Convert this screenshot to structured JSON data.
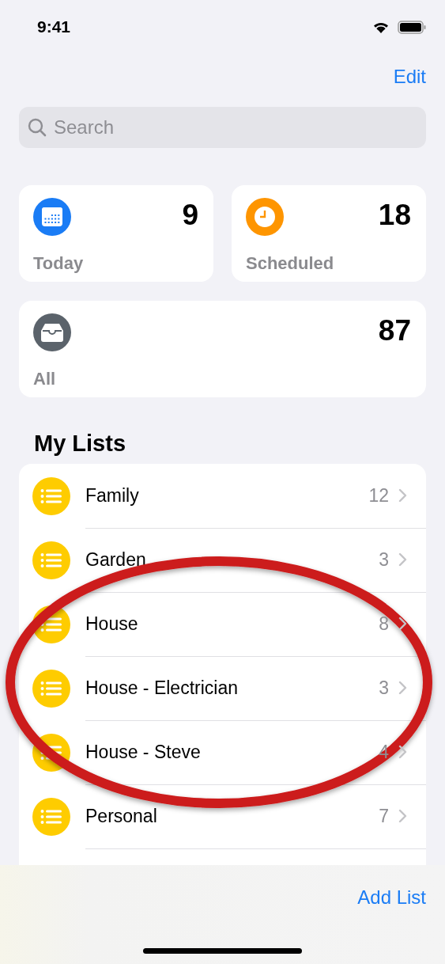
{
  "status_bar": {
    "time": "9:41"
  },
  "nav": {
    "edit": "Edit"
  },
  "search": {
    "placeholder": "Search"
  },
  "smart_lists": [
    {
      "kind": "calendar",
      "label": "Today",
      "count": "9",
      "color": "#1a7cf5"
    },
    {
      "kind": "clock",
      "label": "Scheduled",
      "count": "18",
      "color": "#fe9500"
    },
    {
      "kind": "tray",
      "label": "All",
      "count": "87",
      "color": "#5b636b"
    }
  ],
  "section_title": "My Lists",
  "lists": [
    {
      "name": "Family",
      "count": "12",
      "color": "#fecc00"
    },
    {
      "name": "Garden",
      "count": "3",
      "color": "#fecc00"
    },
    {
      "name": "House",
      "count": "8",
      "color": "#fecc00"
    },
    {
      "name": "House - Electrician",
      "count": "3",
      "color": "#fecc00"
    },
    {
      "name": "House - Steve",
      "count": "4",
      "color": "#fecc00"
    },
    {
      "name": "Personal",
      "count": "7",
      "color": "#fecc00"
    }
  ],
  "annotation": {
    "kind": "ellipse",
    "color": "#cc1a1a"
  },
  "toolbar": {
    "add_list": "Add List"
  }
}
